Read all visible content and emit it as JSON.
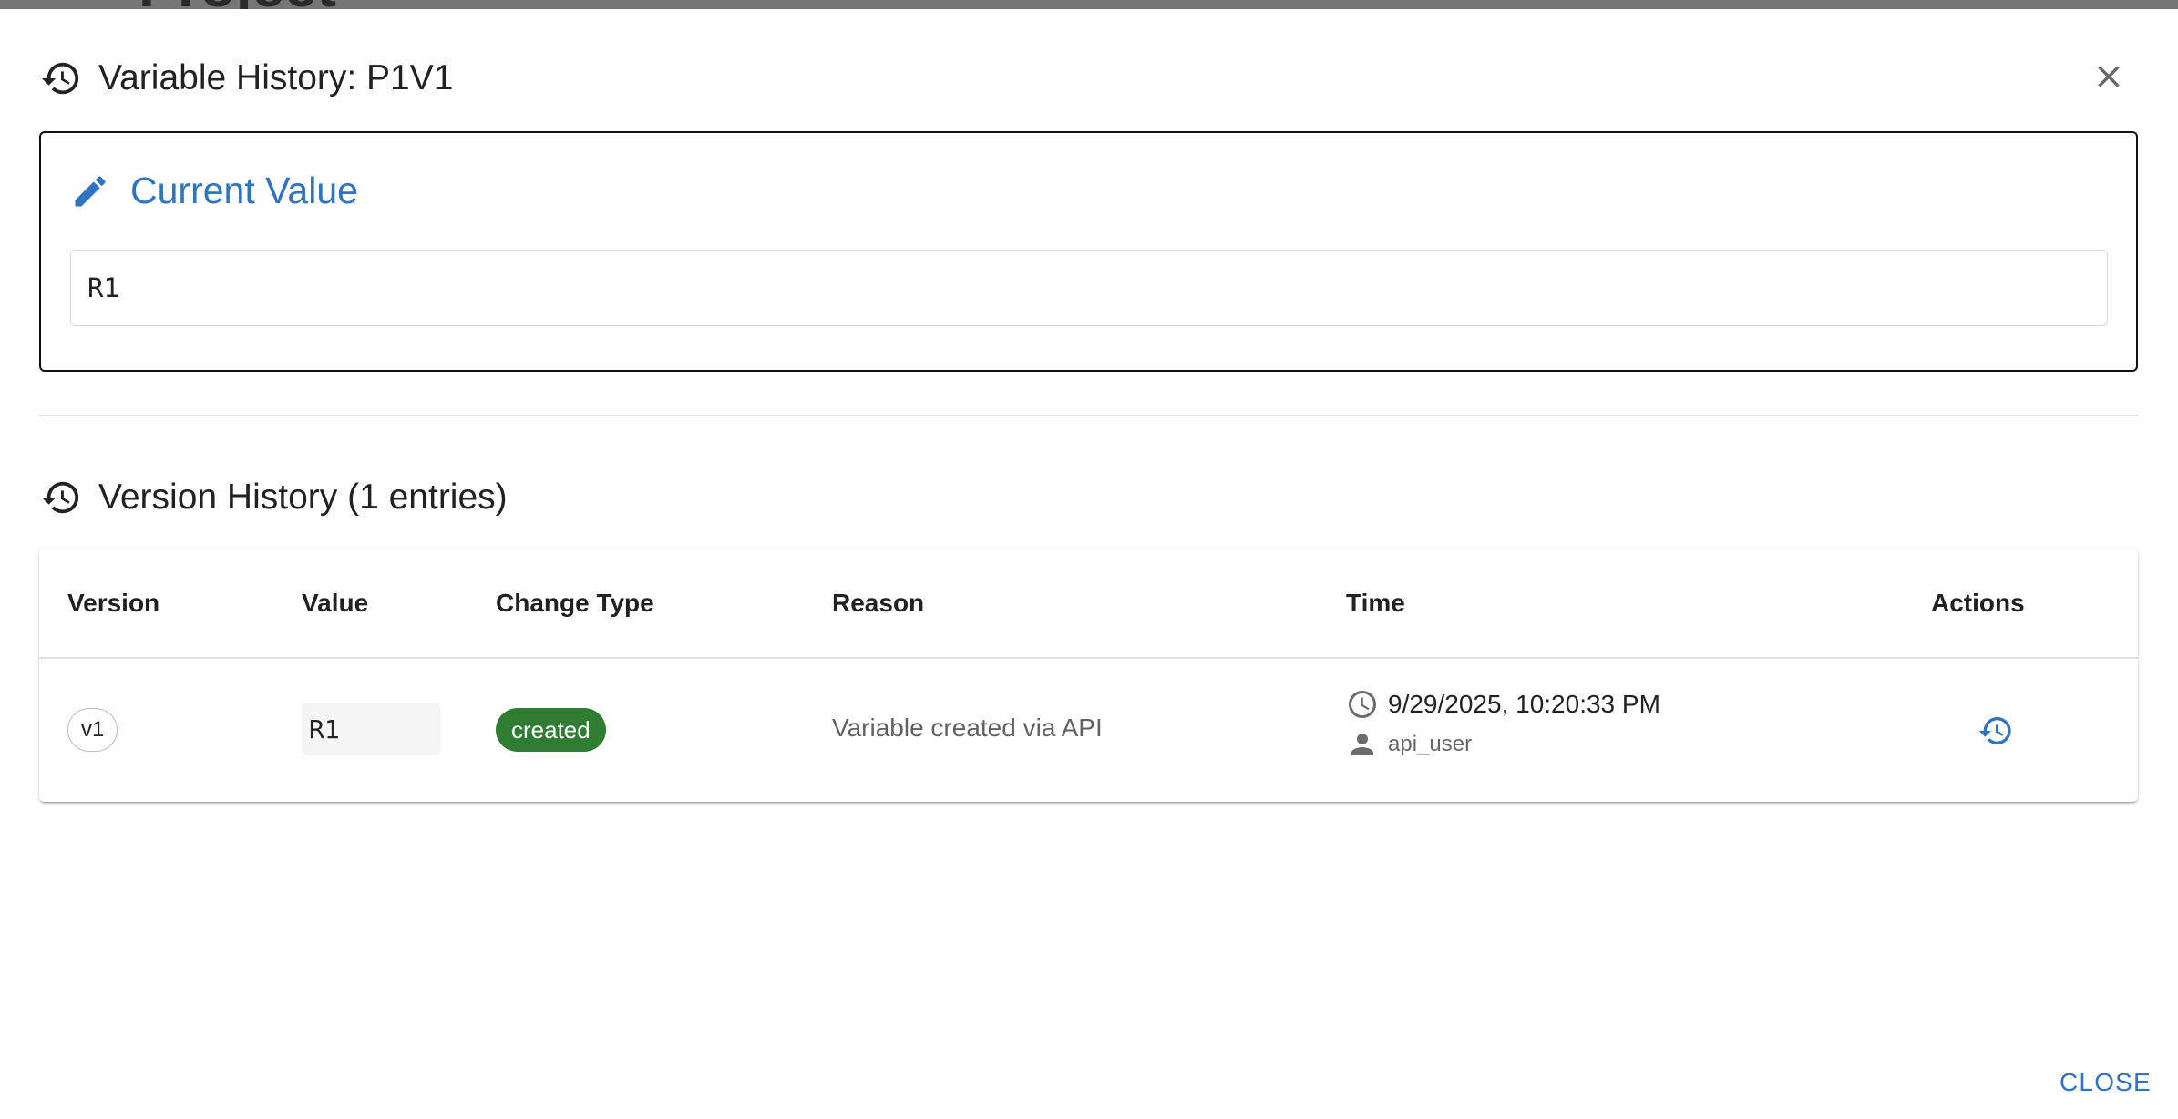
{
  "background": {
    "title": "Project"
  },
  "dialog": {
    "title": "Variable History: P1V1",
    "header_icon": "history-icon",
    "close_icon": "close-icon"
  },
  "current_value": {
    "heading": "Current Value",
    "icon": "pencil-icon",
    "value": "R1",
    "accent_color": "#2f73c2"
  },
  "version_history": {
    "heading": "Version History (1 entries)",
    "icon": "history-icon",
    "columns": [
      "Version",
      "Value",
      "Change Type",
      "Reason",
      "Time",
      "Actions"
    ],
    "rows": [
      {
        "version": "v1",
        "value": "R1",
        "change_type": "created",
        "change_type_color": "#2f7d32",
        "reason": "Variable created via API",
        "time": "9/29/2025, 10:20:33 PM",
        "user": "api_user",
        "action_icon": "restore-history-icon"
      }
    ]
  },
  "footer": {
    "close_label": "CLOSE"
  }
}
